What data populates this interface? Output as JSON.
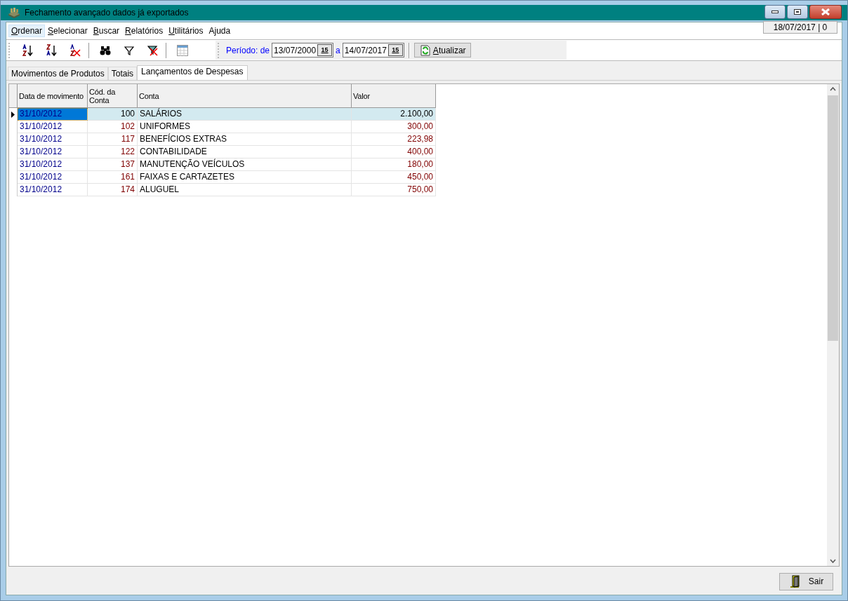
{
  "window": {
    "title": "Fechamento avançado dados já exportados"
  },
  "menu": [
    {
      "label": "Ordenar",
      "underlined_first": true,
      "selected": true
    },
    {
      "label": "Selecionar",
      "underlined_first": true,
      "selected": false
    },
    {
      "label": "Buscar",
      "underlined_first": true,
      "selected": false
    },
    {
      "label": "Relatórios",
      "underlined_first": true,
      "selected": false
    },
    {
      "label": "Utilitários",
      "underlined_first": true,
      "selected": false
    },
    {
      "label": "Ajuda",
      "underlined_first": false,
      "selected": false
    }
  ],
  "date_status": "18/07/2017 | 0",
  "period": {
    "label": "Período: de",
    "from": "13/07/2000",
    "separator": "a",
    "from_calendar": "15",
    "to": "14/07/2017",
    "to_calendar": "15",
    "refresh_button": "Atualizar"
  },
  "tabs": [
    {
      "label": "Movimentos de Produtos",
      "selected": false
    },
    {
      "label": "Totais",
      "selected": false
    },
    {
      "label": "Lançamentos de Despesas",
      "selected": true
    }
  ],
  "table": {
    "columns": [
      "Data de movimento",
      "Cód. da Conta",
      "Conta",
      "Valor"
    ],
    "rows": [
      {
        "date": "31/10/2012",
        "code": "100",
        "account": "SALÁRIOS",
        "value": "2.100,00",
        "selected": true
      },
      {
        "date": "31/10/2012",
        "code": "102",
        "account": "UNIFORMES",
        "value": "300,00",
        "selected": false
      },
      {
        "date": "31/10/2012",
        "code": "117",
        "account": "BENEFÍCIOS EXTRAS",
        "value": "223,98",
        "selected": false
      },
      {
        "date": "31/10/2012",
        "code": "122",
        "account": "CONTABILIDADE",
        "value": "400,00",
        "selected": false
      },
      {
        "date": "31/10/2012",
        "code": "137",
        "account": "MANUTENÇÃO VEÍCULOS",
        "value": "180,00",
        "selected": false
      },
      {
        "date": "31/10/2012",
        "code": "161",
        "account": "FAIXAS E CARTAZETES",
        "value": "450,00",
        "selected": false
      },
      {
        "date": "31/10/2012",
        "code": "174",
        "account": "ALUGUEL",
        "value": "750,00",
        "selected": false
      }
    ]
  },
  "exit_button": "Sair"
}
